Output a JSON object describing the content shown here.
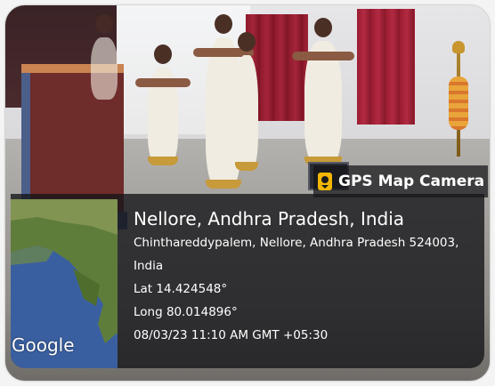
{
  "brand": {
    "label": "GPS Map Camera",
    "icon": "map-pin-icon",
    "icon_color": "#f2b705"
  },
  "location": {
    "title": "Nellore, Andhra Pradesh, India",
    "address_line1": "Chinthareddypalem, Nellore, Andhra Pradesh 524003,",
    "address_line2": "India",
    "lat": "Lat 14.424548°",
    "long": "Long 80.014896°",
    "datetime": "08/03/23 11:10 AM GMT +05:30"
  },
  "map": {
    "provider_logo": "Google",
    "land_color": "#5f7d3a",
    "water_color": "#3a5fa0"
  },
  "colors": {
    "overlay": "#16161a",
    "text": "#ffffff"
  }
}
